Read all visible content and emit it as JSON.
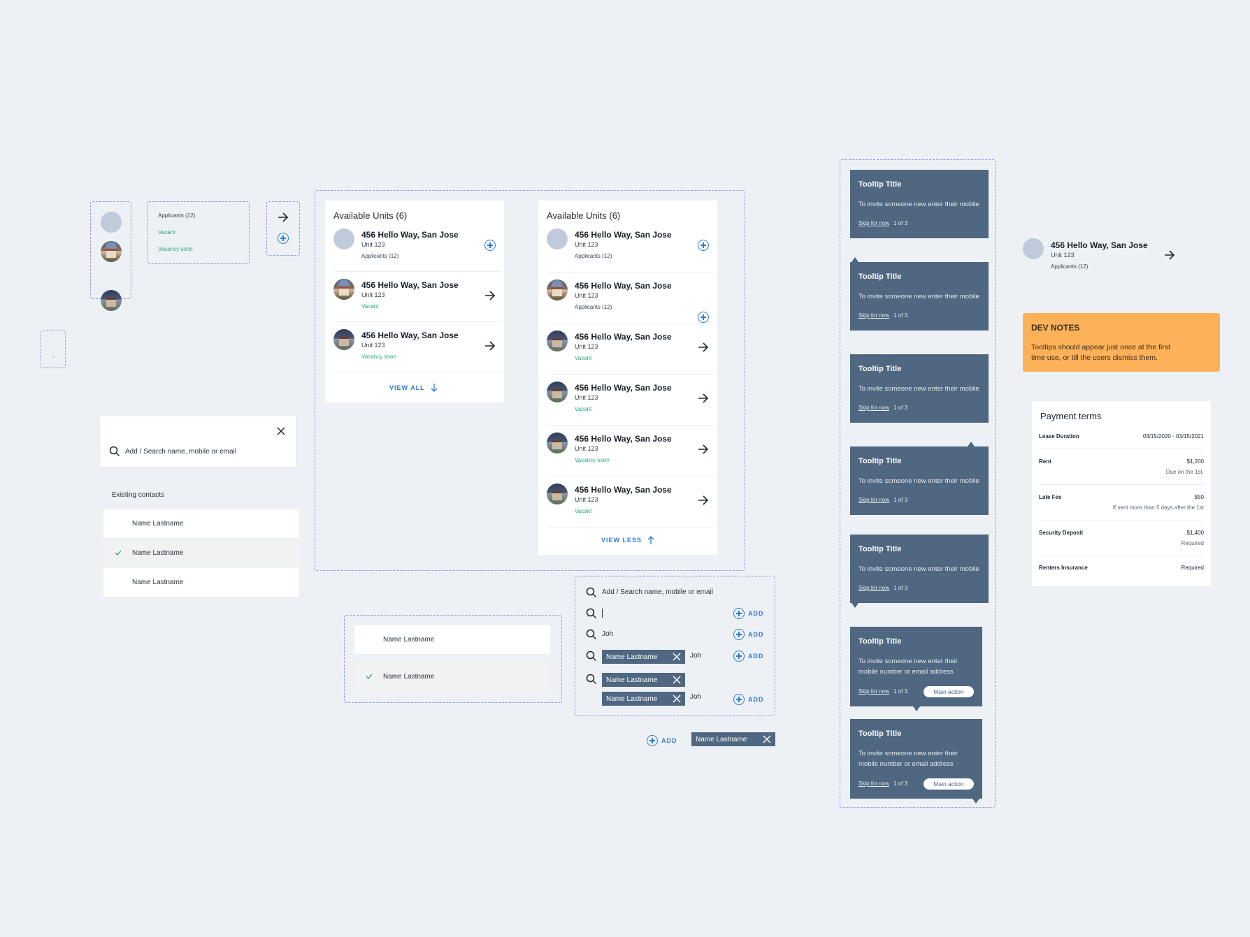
{
  "component_states": {
    "applicants": "Applicants (12)",
    "vacant": "Vacant",
    "vacancy_soon": "Vacancy soon"
  },
  "units_card_short": {
    "title": "Available Units (6)",
    "units": [
      {
        "address": "456 Hello Way, San Jose",
        "unit": "Unit 123",
        "status": "Applicants (12)"
      },
      {
        "address": "456 Hello Way, San Jose",
        "unit": "Unit 123",
        "status": "Vacant"
      },
      {
        "address": "456 Hello Way, San Jose",
        "unit": "Unit 123",
        "status": "Vacancy soon"
      }
    ],
    "view_all": "VIEW ALL"
  },
  "units_card_long": {
    "title": "Available Units (6)",
    "units": [
      {
        "address": "456 Hello Way, San Jose",
        "unit": "Unit 123",
        "status": "Applicants (12)"
      },
      {
        "address": "456 Hello Way, San Jose",
        "unit": "Unit 123",
        "status": "Applicants (12)"
      },
      {
        "address": "456 Hello Way, San Jose",
        "unit": "Unit 123",
        "status": "Vacant"
      },
      {
        "address": "456 Hello Way, San Jose",
        "unit": "Unit 123",
        "status": "Vacant"
      },
      {
        "address": "456 Hello Way, San Jose",
        "unit": "Unit 123",
        "status": "Vacancy soon"
      },
      {
        "address": "456 Hello Way, San Jose",
        "unit": "Unit 123",
        "status": "Vacant"
      }
    ],
    "view_less": "VIEW LESS"
  },
  "search_panel": {
    "placeholder": "Add / Search name, mobile or email",
    "existing_label": "Existing contacts",
    "contacts": [
      "Name Lastname",
      "Name Lastname",
      "Name Lastname"
    ]
  },
  "contact_states": [
    "Name Lastname",
    "Name Lastname"
  ],
  "search_states": {
    "placeholder": "Add / Search name, mobile or email",
    "typed": "Joh",
    "chip": "Name Lastname",
    "add": "ADD"
  },
  "standalone": {
    "add": "ADD",
    "chip": "Name Lastname"
  },
  "tooltips": {
    "title": "Tooltip Title",
    "body_clipped": "To invite someone new enter their mobile",
    "body_line1": "To invite someone new enter their",
    "body_line2": "mobile number or email address",
    "skip": "Skip for now",
    "step": "1 of 3",
    "action": "Main action"
  },
  "unit_row": {
    "address": "456 Hello Way, San Jose",
    "unit": "Unit 123",
    "status": "Applicants (12)"
  },
  "dev_notes": {
    "title": "DEV NOTES",
    "text_line1": "Tooltips should appear just once at the first",
    "text_line2": "time use, or till the users dismiss them."
  },
  "payment_terms": {
    "title": "Payment terms",
    "rows": [
      {
        "label": "Lease Duration",
        "value": "03/15/2020 - 03/15/2021",
        "note": ""
      },
      {
        "label": "Rent",
        "value": "$1,200",
        "note": "Due on the 1st."
      },
      {
        "label": "Late Fee",
        "value": "$50",
        "note": "If sent more than 5 days after the 1st"
      },
      {
        "label": "Security Deposit",
        "value": "$1,400",
        "note": "Required"
      },
      {
        "label": "Renters Insurance",
        "value": "Required",
        "note": ""
      }
    ]
  },
  "colors": {
    "background": "#edf1f6",
    "accent_blue": "#2f7ad3",
    "status_green": "#27a77a",
    "tooltip_bg": "#4f6780",
    "dev_notes_bg": "#fdb259",
    "dashed_frame": "#8f95f3"
  }
}
